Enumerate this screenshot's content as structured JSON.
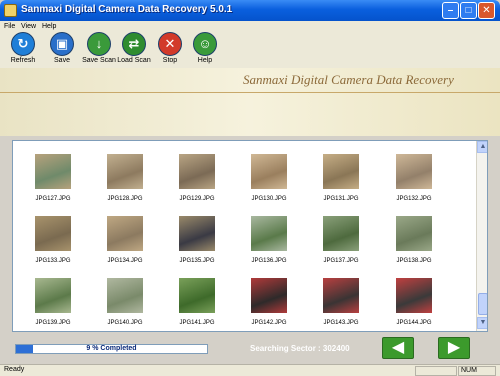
{
  "window": {
    "title": "Sanmaxi Digital Camera Data Recovery 5.0.1"
  },
  "menu": [
    "File",
    "View",
    "Help"
  ],
  "toolbar": [
    {
      "label": "Refresh",
      "icon": "refresh-icon",
      "color": "#1f7fd8",
      "glyph": "↻"
    },
    {
      "label": "Save",
      "icon": "save-icon",
      "color": "#2a6fc9",
      "glyph": "▣"
    },
    {
      "label": "Save Scan",
      "icon": "save-scan-icon",
      "color": "#3a9a3a",
      "glyph": "↓"
    },
    {
      "label": "Load Scan",
      "icon": "load-scan-icon",
      "color": "#2f8c2f",
      "glyph": "⇄"
    },
    {
      "label": "Stop",
      "icon": "stop-icon",
      "color": "#d23a2a",
      "glyph": "✕"
    },
    {
      "label": "Help",
      "icon": "help-icon",
      "color": "#3a9a3a",
      "glyph": "☺"
    }
  ],
  "banner": {
    "title": "Sanmaxi Digital Camera Data Recovery"
  },
  "gallery": {
    "rows": [
      [
        {
          "name": "JPG127.JPG",
          "c1": "#6f8a6a",
          "c2": "#b7a27d"
        },
        {
          "name": "JPG128.JPG",
          "c1": "#8d7a5f",
          "c2": "#c2b090"
        },
        {
          "name": "JPG129.JPG",
          "c1": "#7b6a55",
          "c2": "#b9a584"
        },
        {
          "name": "JPG130.JPG",
          "c1": "#9a7f5e",
          "c2": "#d0b895"
        },
        {
          "name": "JPG131.JPG",
          "c1": "#8a7656",
          "c2": "#c6ae86"
        },
        {
          "name": "JPG132.JPG",
          "c1": "#93806a",
          "c2": "#cfb898"
        }
      ],
      [
        {
          "name": "JPG133.JPG",
          "c1": "#7a6a50",
          "c2": "#a8936c"
        },
        {
          "name": "JPG134.JPG",
          "c1": "#8c7a60",
          "c2": "#bfa883"
        },
        {
          "name": "JPG135.JPG",
          "c1": "#3a3a44",
          "c2": "#9a8a6a"
        },
        {
          "name": "JPG136.JPG",
          "c1": "#5a7a4a",
          "c2": "#a9b8a0"
        },
        {
          "name": "JPG137.JPG",
          "c1": "#4e6a3e",
          "c2": "#8aa07a"
        },
        {
          "name": "JPG138.JPG",
          "c1": "#6a7a5a",
          "c2": "#9aa888"
        }
      ],
      [
        {
          "name": "JPG139.JPG",
          "c1": "#5c7a4a",
          "c2": "#a8b890"
        },
        {
          "name": "JPG140.JPG",
          "c1": "#7a8a6a",
          "c2": "#b0b8a0"
        },
        {
          "name": "JPG141.JPG",
          "c1": "#3e6a2a",
          "c2": "#7aa05a"
        },
        {
          "name": "JPG142.JPG",
          "c1": "#2e2a2a",
          "c2": "#b03a3a"
        },
        {
          "name": "JPG143.JPG",
          "c1": "#3a3434",
          "c2": "#b84040"
        },
        {
          "name": "JPG144.JPG",
          "c1": "#3a3a3a",
          "c2": "#c04040"
        }
      ]
    ]
  },
  "progress": {
    "text": "9 % Completed",
    "value": 0.09
  },
  "sector": {
    "label": "Searching Sector : 302400"
  },
  "nav": {
    "prev": "◀",
    "next": "▶"
  },
  "status": {
    "text": "Ready",
    "cell2": "NUM"
  }
}
